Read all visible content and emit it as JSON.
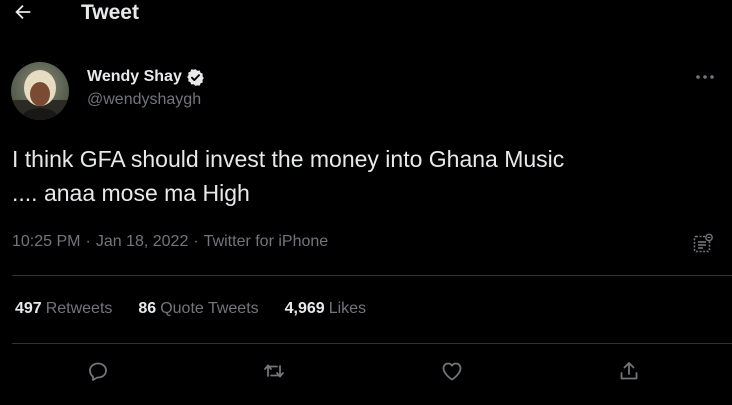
{
  "header": {
    "title": "Tweet",
    "back_icon": "arrow-left-icon"
  },
  "tweet": {
    "author": {
      "display_name": "Wendy Shay",
      "handle": "@wendyshaygh",
      "verified": true
    },
    "text": "I think GFA should invest the money into Ghana Music\n.... anaa mose ma High",
    "time": "10:25 PM",
    "separator": "·",
    "date": "Jan 18, 2022",
    "source": "Twitter for iPhone"
  },
  "stats": {
    "retweets": {
      "count": "497",
      "label": "Retweets"
    },
    "quote_tweets": {
      "count": "86",
      "label": "Quote Tweets"
    },
    "likes": {
      "count": "4,969",
      "label": "Likes"
    }
  },
  "actions": [
    "reply-icon",
    "retweet-icon",
    "like-icon",
    "share-icon"
  ],
  "colors": {
    "background": "#000000",
    "text_primary": "#e7e9ea",
    "text_secondary": "#71767b",
    "divider": "#2f3336",
    "verified_badge": "#e7e9ea"
  }
}
